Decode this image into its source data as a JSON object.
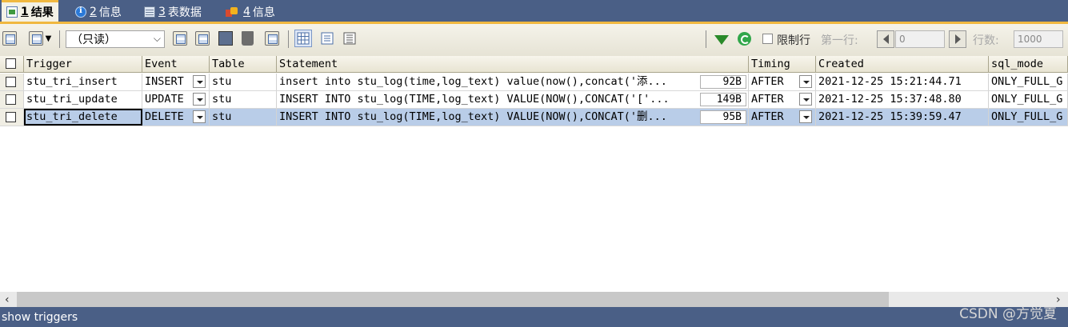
{
  "tabs": [
    {
      "num": "1",
      "label": "结果",
      "icon": "result-icon",
      "active": true
    },
    {
      "num": "2",
      "label": "信息",
      "icon": "info-icon",
      "active": false
    },
    {
      "num": "3",
      "label": "表数据",
      "icon": "table-data-icon",
      "active": false
    },
    {
      "num": "4",
      "label": "信息",
      "icon": "info-chart-icon",
      "active": false
    }
  ],
  "toolbar": {
    "mode_select": "（只读）",
    "limit_label": "限制行",
    "first_row_label": "第一行:",
    "first_row_value": "0",
    "rows_label": "行数:",
    "rows_value": "1000"
  },
  "grid": {
    "columns": [
      "Trigger",
      "Event",
      "Table",
      "Statement",
      "Timing",
      "Created",
      "sql_mode"
    ],
    "rows": [
      {
        "trigger": "stu_tri_insert",
        "event": "INSERT",
        "table": "stu",
        "statement": "insert into stu_log(time,log_text) value(now(),concat('添...",
        "size": "92B",
        "timing": "AFTER",
        "created": "2021-12-25 15:21:44.71",
        "sql_mode": "ONLY_FULL_G"
      },
      {
        "trigger": "stu_tri_update",
        "event": "UPDATE",
        "table": "stu",
        "statement": "INSERT INTO stu_log(TIME,log_text) VALUE(NOW(),CONCAT('['...",
        "size": "149B",
        "timing": "AFTER",
        "created": "2021-12-25 15:37:48.80",
        "sql_mode": "ONLY_FULL_G"
      },
      {
        "trigger": "stu_tri_delete",
        "event": "DELETE",
        "table": "stu",
        "statement": "INSERT INTO stu_log(TIME,log_text) VALUE(NOW(),CONCAT('删...",
        "size": "95B",
        "timing": "AFTER",
        "created": "2021-12-25 15:39:59.47",
        "sql_mode": "ONLY_FULL_G"
      }
    ]
  },
  "statusbar": {
    "text": "show triggers"
  },
  "watermark": "CSDN @方觉夏",
  "colors": {
    "chrome": "#4a5f86",
    "accent": "#f0b840",
    "selected_row": "#b9cde8",
    "header": "#ece9d8"
  }
}
